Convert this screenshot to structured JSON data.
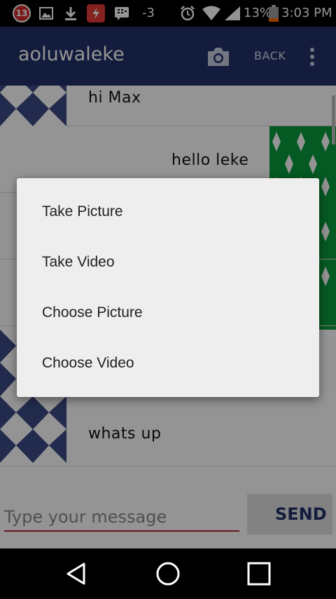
{
  "status_bar": {
    "notif_count": "13",
    "rf_text": "-3",
    "battery_text": "13%",
    "time": "3:03 PM"
  },
  "toolbar": {
    "title": "aoluwaleke",
    "back_label": "BACK",
    "camera_icon": "camera-icon",
    "more_icon": "overflow-menu-icon"
  },
  "messages": [
    {
      "text": "hi Max",
      "side": "left"
    },
    {
      "text": "hello leke",
      "side": "right"
    },
    {
      "text": "whats up",
      "side": "left"
    }
  ],
  "input": {
    "placeholder": "Type your message",
    "send_label": "SEND"
  },
  "dialog": {
    "items": [
      "Take Picture",
      "Take Video",
      "Choose Picture",
      "Choose Video"
    ]
  },
  "colors": {
    "toolbar": "#22316a",
    "accent": "#b3262f",
    "avatar_blue": "#3b4a86",
    "avatar_green": "#0a9a3c"
  }
}
